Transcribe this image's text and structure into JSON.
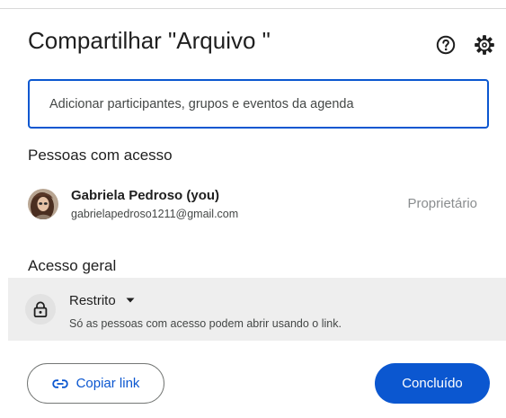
{
  "dialog": {
    "title": "Compartilhar \"Arquivo \"",
    "icons": {
      "help": "help-circle-icon",
      "settings": "gear-icon"
    }
  },
  "share_input": {
    "placeholder": "Adicionar participantes, grupos e eventos da agenda",
    "value": ""
  },
  "people_section": {
    "heading": "Pessoas com acesso",
    "people": [
      {
        "name": "Gabriela Pedroso (you)",
        "email": "gabrielapedroso1211@gmail.com",
        "role": "Proprietário",
        "avatar": "user-photo-avatar"
      }
    ]
  },
  "general_access": {
    "heading": "Acesso geral",
    "selected": "Restrito",
    "description": "Só as pessoas com acesso podem abrir usando o link.",
    "icon": "lock-icon"
  },
  "actions": {
    "copy_link_label": "Copiar link",
    "copy_link_icon": "link-icon",
    "done_label": "Concluído"
  },
  "colors": {
    "accent": "#0b57d0",
    "role_text": "#8a8d8f",
    "access_row_bg": "#eeeeee"
  }
}
